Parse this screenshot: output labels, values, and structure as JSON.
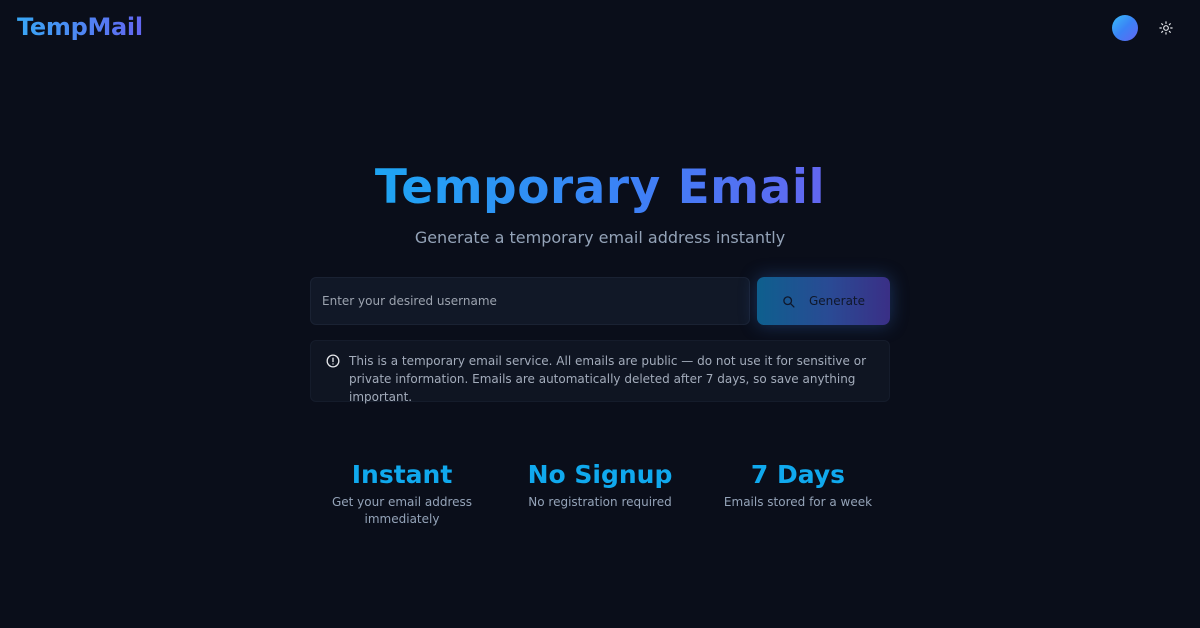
{
  "header": {
    "logo": "TempMail",
    "theme_toggle_icon": "sun-icon",
    "avatar_icon": "avatar"
  },
  "hero": {
    "title": "Temporary Email",
    "subtitle": "Generate a temporary email address instantly"
  },
  "form": {
    "username_placeholder": "Enter your desired username",
    "username_value": "",
    "generate_label": "Generate",
    "generate_icon": "search-icon"
  },
  "notice": {
    "icon": "alert-circle-icon",
    "text": "This is a temporary email service. All emails are public — do not use it for sensitive or private information. Emails are automatically deleted after 7 days, so save anything important."
  },
  "features": [
    {
      "title": "Instant",
      "description": "Get your email address immediately"
    },
    {
      "title": "No Signup",
      "description": "No registration required"
    },
    {
      "title": "7 Days",
      "description": "Emails stored for a week"
    }
  ],
  "colors": {
    "background": "#0a0e1a",
    "accent_cyan": "#10a9ee",
    "accent_indigo": "#6366f1"
  }
}
